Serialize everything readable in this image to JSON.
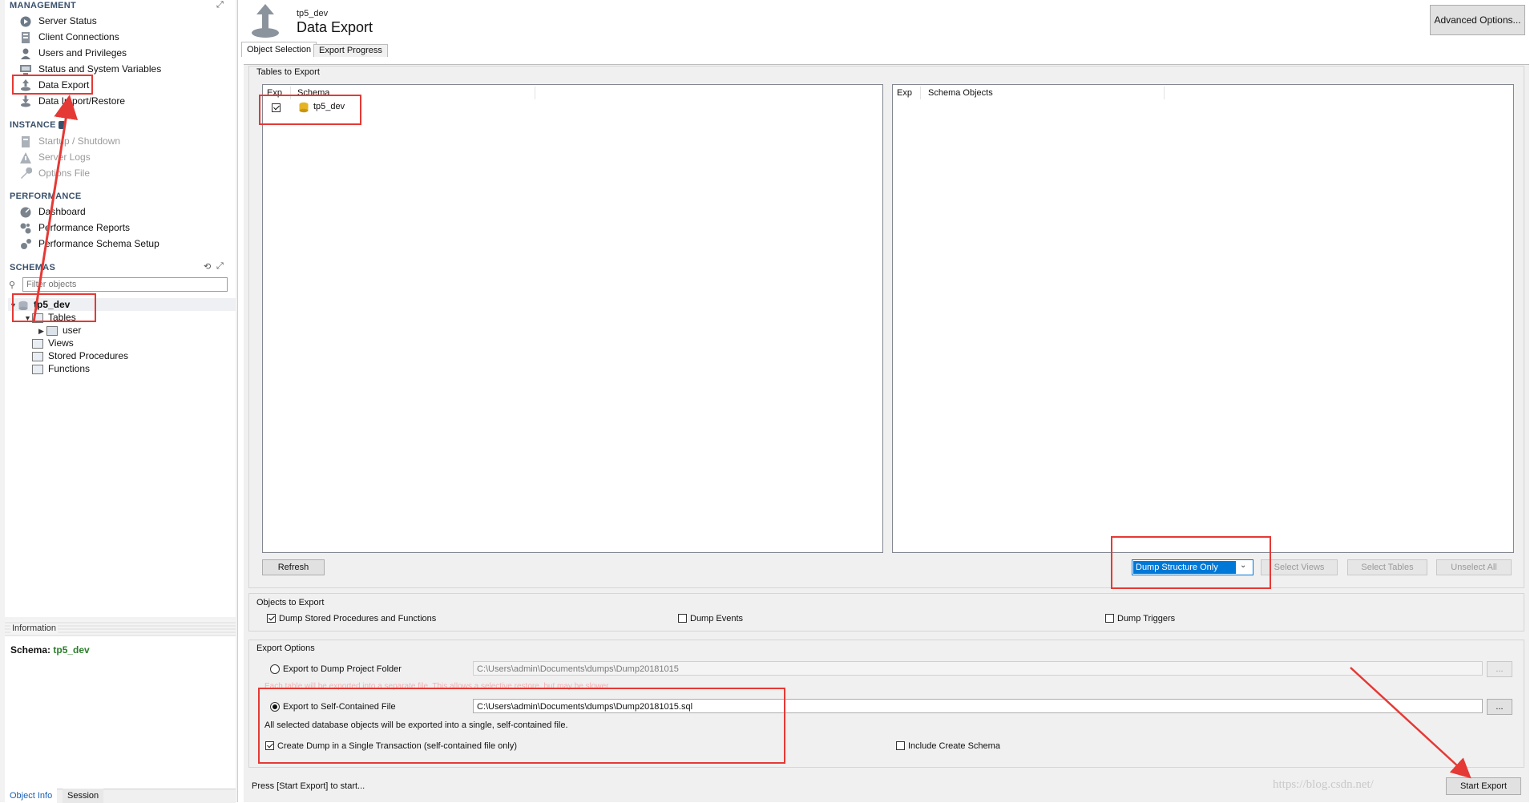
{
  "sidebar": {
    "management": {
      "title": "MANAGEMENT",
      "items": [
        {
          "label": "Server Status"
        },
        {
          "label": "Client Connections"
        },
        {
          "label": "Users and Privileges"
        },
        {
          "label": "Status and System Variables"
        },
        {
          "label": "Data Export"
        },
        {
          "label": "Data Import/Restore"
        }
      ]
    },
    "instance": {
      "title": "INSTANCE",
      "items": [
        {
          "label": "Startup / Shutdown"
        },
        {
          "label": "Server Logs"
        },
        {
          "label": "Options File"
        }
      ]
    },
    "performance": {
      "title": "PERFORMANCE",
      "items": [
        {
          "label": "Dashboard"
        },
        {
          "label": "Performance Reports"
        },
        {
          "label": "Performance Schema Setup"
        }
      ]
    },
    "schemas": {
      "title": "SCHEMAS",
      "filter_placeholder": "Filter objects",
      "schema_name": "tp5_dev",
      "tables_label": "Tables",
      "table_user": "user",
      "views_label": "Views",
      "procs_label": "Stored Procedures",
      "functions_label": "Functions"
    },
    "info": {
      "header": "Information",
      "schema_label": "Schema:",
      "schema_value": "tp5_dev"
    },
    "bottom_tabs": [
      "Object Info",
      "Session"
    ]
  },
  "header": {
    "subtitle": "tp5_dev",
    "title": "Data Export",
    "advanced_button": "Advanced Options..."
  },
  "tabs": [
    "Object Selection",
    "Export Progress"
  ],
  "tables_to_export": {
    "label": "Tables to Export",
    "left_cols": [
      "Exp",
      "Schema"
    ],
    "rows": [
      {
        "name": "tp5_dev",
        "checked": true
      }
    ],
    "right_cols": [
      "Exp",
      "Schema Objects"
    ],
    "refresh_button": "Refresh",
    "dump_select": "Dump Structure Only",
    "select_views": "Select Views",
    "select_tables": "Select Tables",
    "unselect_all": "Unselect All"
  },
  "objects_to_export": {
    "label": "Objects to Export",
    "routines": "Dump Stored Procedures and Functions",
    "events": "Dump Events",
    "triggers": "Dump Triggers"
  },
  "export_options": {
    "label": "Export Options",
    "dump_folder_label": "Export to Dump Project Folder",
    "dump_folder_path": "C:\\Users\\admin\\Documents\\dumps\\Dump20181015",
    "dump_folder_hint": "Each table will be exported into a separate file. This allows a selective restore, but may be slower.",
    "self_contained_label": "Export to Self-Contained File",
    "self_contained_path": "C:\\Users\\admin\\Documents\\dumps\\Dump20181015.sql",
    "self_contained_hint": "All selected database objects will be exported into a single, self-contained file.",
    "single_transaction": "Create Dump in a Single Transaction (self-contained file only)",
    "include_schema": "Include Create Schema",
    "browse": "..."
  },
  "footer": {
    "status": "Press [Start Export] to start...",
    "start_button": "Start Export",
    "watermark": "https://blog.csdn.net/"
  },
  "colors": {
    "annotation_red": "#e53935",
    "selected_blue": "#0078d7",
    "schema_green": "#2a7d2a"
  }
}
